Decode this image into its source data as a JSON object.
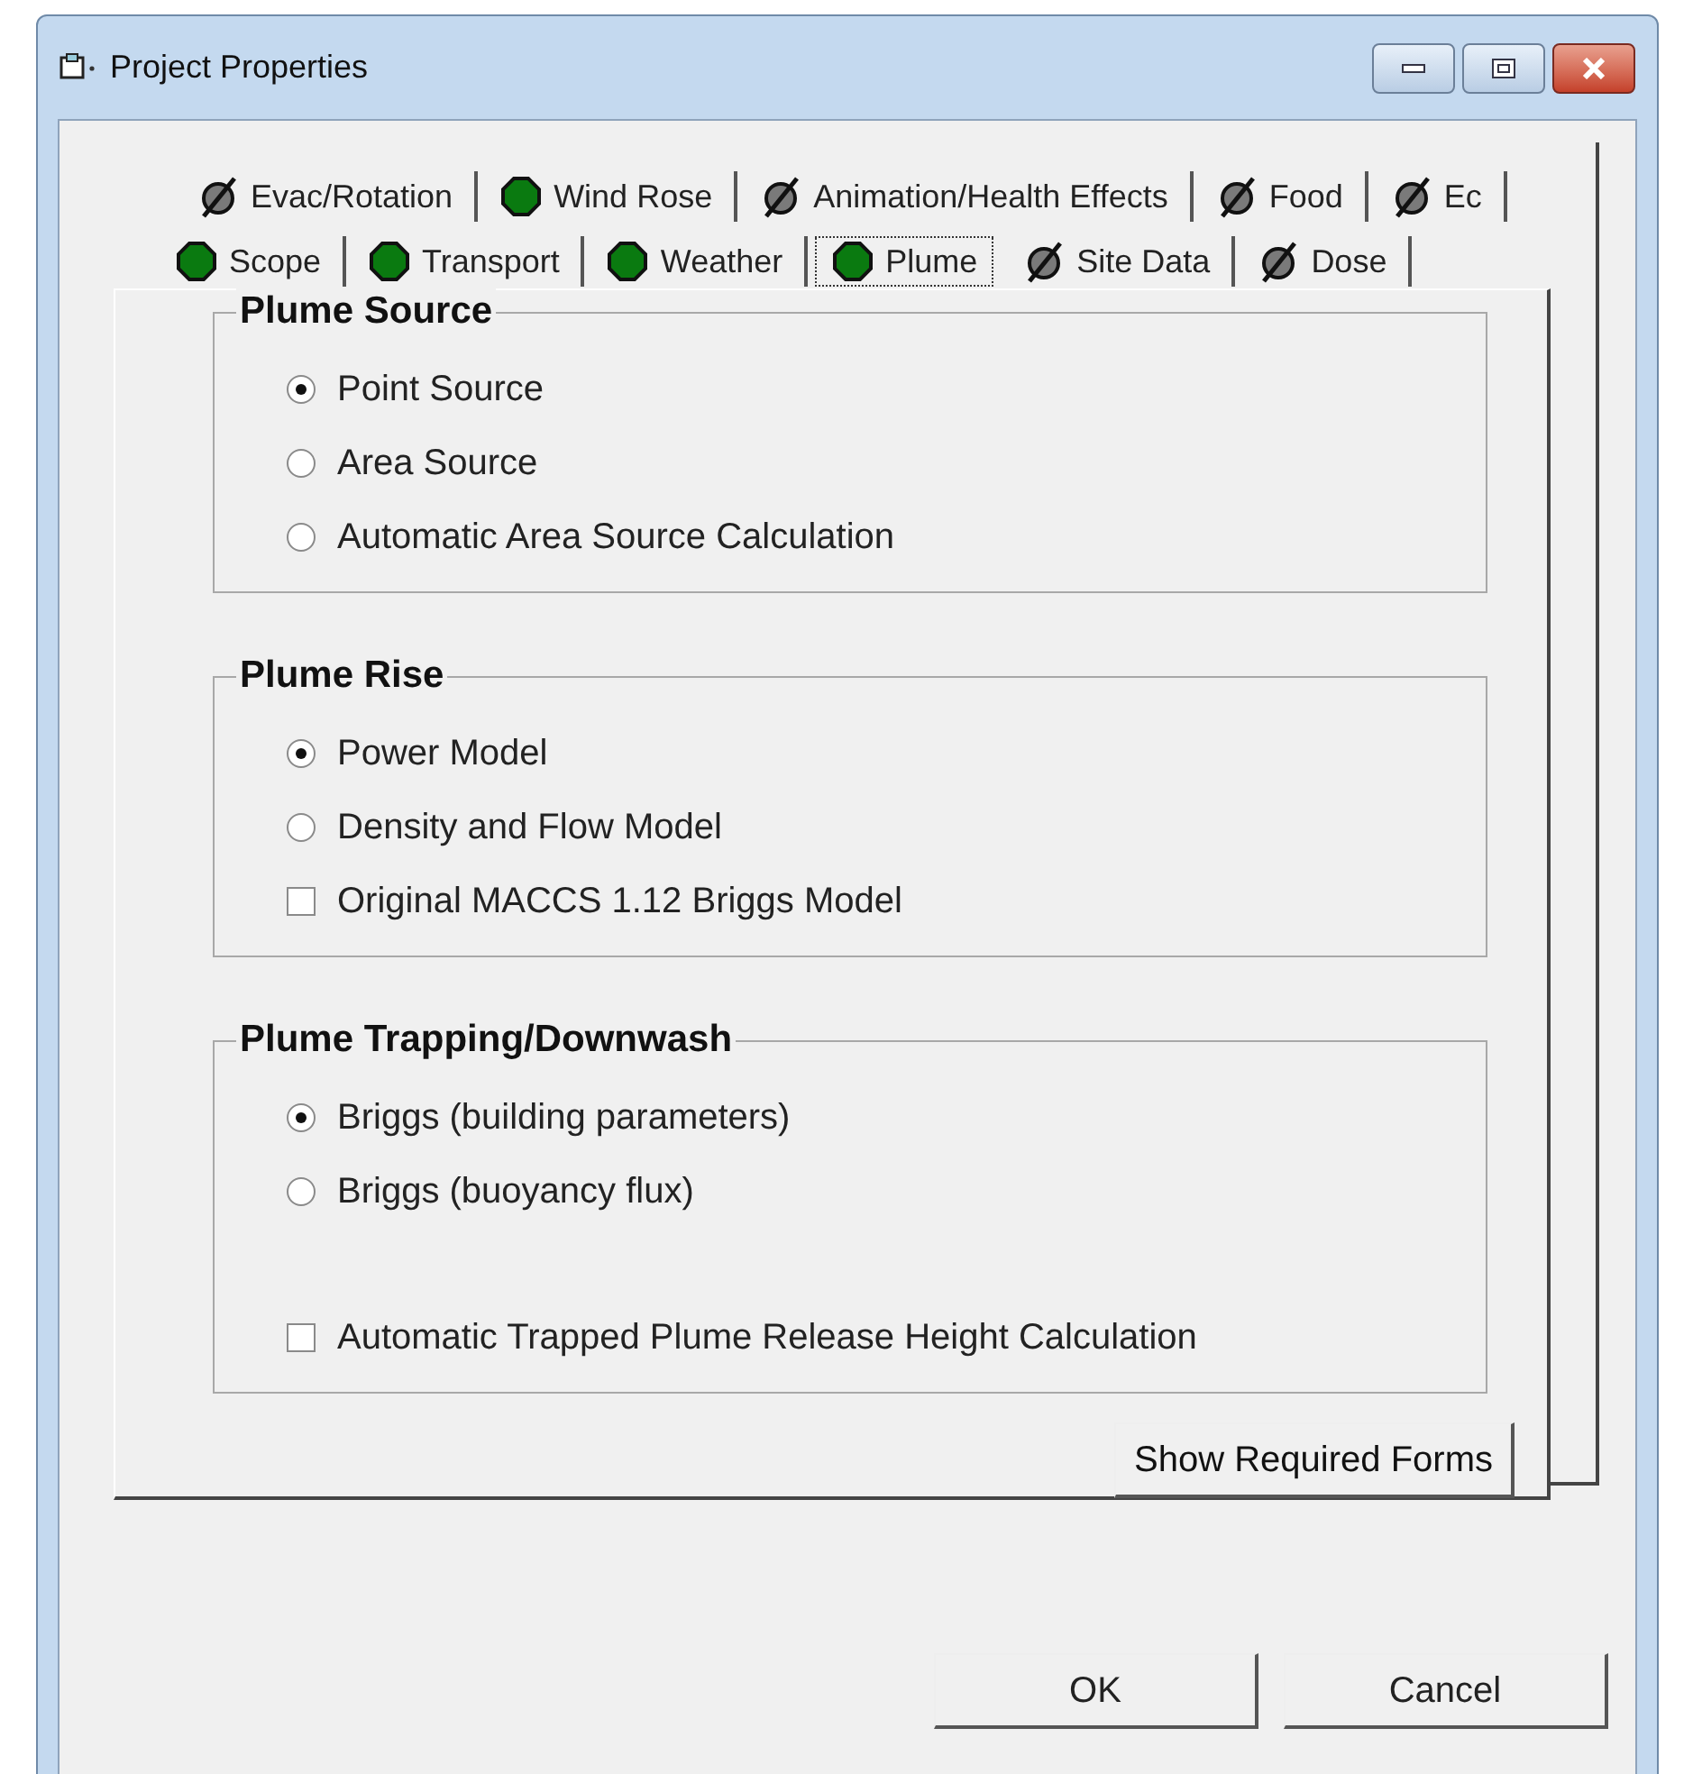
{
  "window": {
    "title": "Project Properties"
  },
  "tab_rows": [
    {
      "tabs": [
        {
          "label": "Evac/Rotation",
          "kind": "incomplete",
          "selected": false
        },
        {
          "label": "Wind Rose",
          "kind": "complete",
          "selected": false
        },
        {
          "label": "Animation/Health Effects",
          "kind": "incomplete",
          "selected": false
        },
        {
          "label": "Food",
          "kind": "incomplete",
          "selected": false
        },
        {
          "label": "Ec",
          "kind": "incomplete",
          "selected": false
        }
      ]
    },
    {
      "tabs": [
        {
          "label": "Scope",
          "kind": "complete",
          "selected": false
        },
        {
          "label": "Transport",
          "kind": "complete",
          "selected": false
        },
        {
          "label": "Weather",
          "kind": "complete",
          "selected": false
        },
        {
          "label": "Plume",
          "kind": "complete",
          "selected": true
        },
        {
          "label": "Site Data",
          "kind": "incomplete",
          "selected": false
        },
        {
          "label": "Dose",
          "kind": "incomplete",
          "selected": false
        }
      ]
    }
  ],
  "groups": [
    {
      "title": "Plume Source",
      "items": [
        {
          "kind": "radio",
          "label": "Point Source",
          "checked": true
        },
        {
          "kind": "radio",
          "label": "Area Source",
          "checked": false
        },
        {
          "kind": "radio",
          "label": "Automatic Area Source Calculation",
          "checked": false
        }
      ]
    },
    {
      "title": "Plume Rise",
      "items": [
        {
          "kind": "radio",
          "label": "Power Model",
          "checked": true
        },
        {
          "kind": "radio",
          "label": "Density and Flow Model",
          "checked": false
        },
        {
          "kind": "checkbox",
          "label": "Original MACCS 1.12 Briggs Model",
          "checked": false
        }
      ]
    },
    {
      "title": "Plume Trapping/Downwash",
      "items": [
        {
          "kind": "radio",
          "label": "Briggs (building parameters)",
          "checked": true
        },
        {
          "kind": "radio",
          "label": "Briggs (buoyancy flux)",
          "checked": false
        },
        {
          "kind": "checkbox",
          "label": "Automatic Trapped Plume Release Height Calculation",
          "checked": false,
          "gap_before": true
        }
      ]
    }
  ],
  "panel_button": "Show Required Forms",
  "buttons": [
    "OK",
    "Cancel"
  ]
}
